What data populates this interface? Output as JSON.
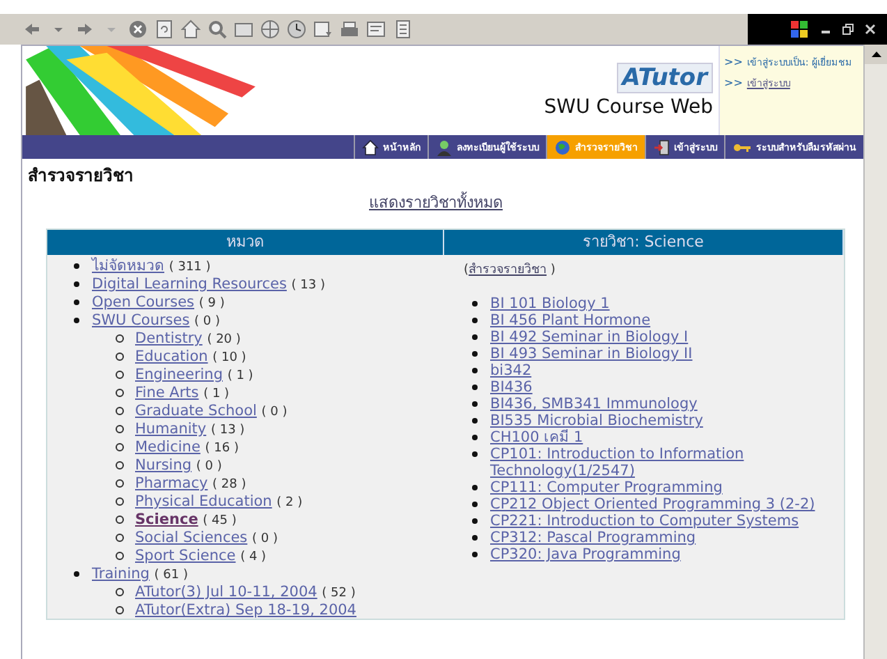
{
  "header": {
    "logo": "ATutor",
    "site_name": "SWU Course Web",
    "user_links": [
      {
        "prefix": ">>",
        "text": "เข้าสู่ระบบเป็น: ผู้เยี่ยมชม"
      },
      {
        "prefix": ">>",
        "text": "เข้าสู่ระบบ"
      }
    ]
  },
  "nav": [
    {
      "label": "หน้าหลัก",
      "selected": false
    },
    {
      "label": "ลงทะเบียนผู้ใช้ระบบ",
      "selected": false
    },
    {
      "label": "สำรวจรายวิชา",
      "selected": true
    },
    {
      "label": "เข้าสู่ระบบ",
      "selected": false
    },
    {
      "label": "ระบบสำหรับลืมรหัสผ่าน",
      "selected": false
    }
  ],
  "page": {
    "title": "สำรวจรายวิชา",
    "show_all_link": "แสดงรายวิชาทั้งหมด"
  },
  "categories": {
    "heading": "หมวด",
    "items": [
      {
        "name": "ไม่จัดหมวด",
        "count": "( 311 )",
        "selected": false
      },
      {
        "name": "Digital Learning Resources",
        "count": "( 13 )",
        "selected": false
      },
      {
        "name": "Open Courses",
        "count": "( 9 )",
        "selected": false
      },
      {
        "name": "SWU Courses",
        "count": "( 0 )",
        "selected": false,
        "children": [
          {
            "name": "Dentistry",
            "count": "( 20 )",
            "selected": false
          },
          {
            "name": "Education",
            "count": "( 10 )",
            "selected": false
          },
          {
            "name": "Engineering",
            "count": "( 1 )",
            "selected": false
          },
          {
            "name": "Fine Arts",
            "count": "( 1 )",
            "selected": false
          },
          {
            "name": "Graduate School",
            "count": "( 0 )",
            "selected": false
          },
          {
            "name": "Humanity",
            "count": "( 13 )",
            "selected": false
          },
          {
            "name": "Medicine",
            "count": "( 16 )",
            "selected": false
          },
          {
            "name": "Nursing",
            "count": "( 0 )",
            "selected": false
          },
          {
            "name": "Pharmacy",
            "count": "( 28 )",
            "selected": false
          },
          {
            "name": "Physical Education",
            "count": "( 2 )",
            "selected": false
          },
          {
            "name": "Science",
            "count": "( 45 )",
            "selected": true
          },
          {
            "name": "Social Sciences",
            "count": "( 0 )",
            "selected": false
          },
          {
            "name": "Sport Science",
            "count": "( 4 )",
            "selected": false
          }
        ]
      },
      {
        "name": "Training",
        "count": "( 61 )",
        "selected": false,
        "children": [
          {
            "name": "ATutor(3) Jul 10-11, 2004",
            "count": "( 52 )",
            "selected": false
          },
          {
            "name": "ATutor(Extra) Sep 18-19, 2004",
            "selected": false
          }
        ]
      }
    ]
  },
  "courses": {
    "heading": "รายวิชา: Science",
    "back_open": "(",
    "back_link": "สำรวจรายวิชา",
    "back_close": ")",
    "items": [
      "BI 101 Biology 1",
      "BI 456 Plant Hormone",
      "BI 492 Seminar in Biology I",
      "BI 493 Seminar in Biology II",
      "bi342",
      "BI436",
      "BI436, SMB341 Immunology",
      "BI535 Microbial Biochemistry",
      "CH100 เคมี 1",
      "CP101: Introduction to Information Technology(1/2547)",
      "CP111: Computer Programming",
      "CP212 Object Oriented Programming 3 (2-2)",
      "CP221: Introduction to Computer Systems",
      "CP312: Pascal Programming",
      "CP320: Java Programming"
    ]
  }
}
